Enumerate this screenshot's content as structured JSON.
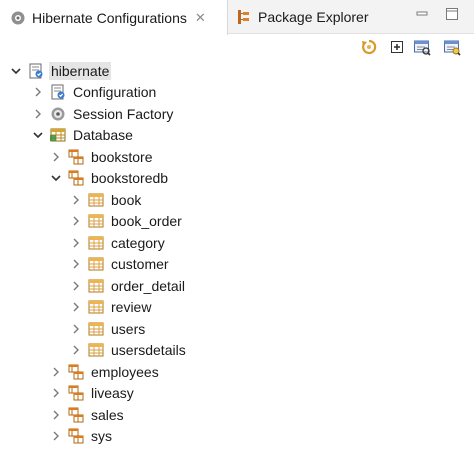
{
  "tabs": [
    {
      "label": "Hibernate Configurations",
      "close": "✕"
    },
    {
      "label": "Package Explorer"
    }
  ],
  "window_controls": [
    "minimize-icon",
    "maximize-icon"
  ],
  "toolbar_icons": [
    "refresh-icon",
    "add-icon",
    "query-icon",
    "criteria-icon"
  ],
  "tree": {
    "root": "hibernate",
    "configuration": "Configuration",
    "session_factory": "Session Factory",
    "database": "Database",
    "schemas": {
      "bookstore": "bookstore",
      "bookstoredb": "bookstoredb",
      "employees": "employees",
      "liveasy": "liveasy",
      "sales": "sales",
      "sys": "sys"
    },
    "tables": [
      "book",
      "book_order",
      "category",
      "customer",
      "order_detail",
      "review",
      "users",
      "usersdetails"
    ]
  }
}
